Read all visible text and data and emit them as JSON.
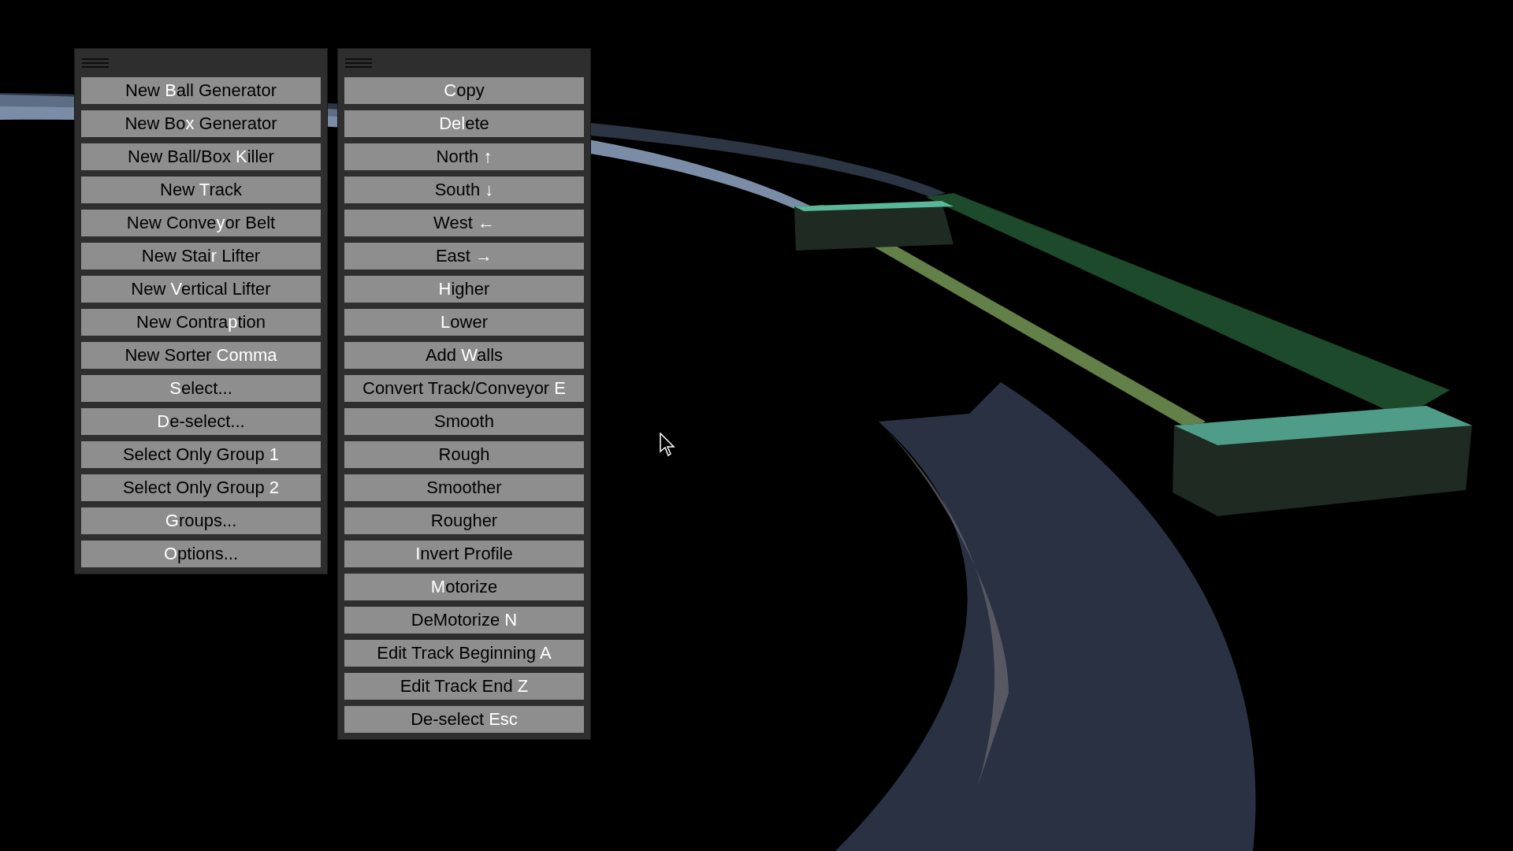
{
  "menus": [
    {
      "buttons": [
        {
          "before": "New ",
          "hotkey": "B",
          "after": "all Generator"
        },
        {
          "before": "New Bo",
          "hotkey": "x",
          "after": " Generator"
        },
        {
          "before": "New Ball/Box ",
          "hotkey": "K",
          "after": "iller"
        },
        {
          "before": "New ",
          "hotkey": "T",
          "after": "rack"
        },
        {
          "before": "New Conve",
          "hotkey": "y",
          "after": "or Belt"
        },
        {
          "before": "New Stai",
          "hotkey": "r",
          "after": " Lifter"
        },
        {
          "before": "New ",
          "hotkey": "V",
          "after": "ertical Lifter"
        },
        {
          "before": "New Contra",
          "hotkey": "p",
          "after": "tion"
        },
        {
          "before": "New Sorter ",
          "hotkey": "Comma"
        },
        {
          "hotkey": "S",
          "after": "elect..."
        },
        {
          "hotkey": "D",
          "after": "e-select..."
        },
        {
          "before": "Select Only Group ",
          "hotkey": "1"
        },
        {
          "before": "Select Only Group ",
          "hotkey": "2"
        },
        {
          "hotkey": "G",
          "after": "roups..."
        },
        {
          "hotkey": "O",
          "after": "ptions..."
        }
      ]
    },
    {
      "buttons": [
        {
          "hotkey": "C",
          "after": "opy"
        },
        {
          "hotkey": "Del",
          "after": "ete"
        },
        {
          "before": "North ",
          "hotkey": "↑"
        },
        {
          "before": "South ",
          "hotkey": "↓"
        },
        {
          "before": "West ",
          "hotkey": "←"
        },
        {
          "before": "East ",
          "hotkey": "→"
        },
        {
          "hotkey": "H",
          "after": "igher"
        },
        {
          "hotkey": "L",
          "after": "ower"
        },
        {
          "before": "Add ",
          "hotkey": "W",
          "after": "alls"
        },
        {
          "before": "Convert Track/Conveyor ",
          "hotkey": "E"
        },
        {
          "before": "Smooth"
        },
        {
          "before": "Rough"
        },
        {
          "before": "Smoother"
        },
        {
          "before": "Rougher"
        },
        {
          "hotkey": "I",
          "after": "nvert Profile"
        },
        {
          "hotkey": "M",
          "after": "otorize"
        },
        {
          "before": "DeMotorize ",
          "hotkey": "N"
        },
        {
          "before": "Edit Track Beginning ",
          "hotkey": "A"
        },
        {
          "before": "Edit Track End ",
          "hotkey": "Z"
        },
        {
          "before": "De-select ",
          "hotkey": "Esc"
        }
      ]
    }
  ]
}
